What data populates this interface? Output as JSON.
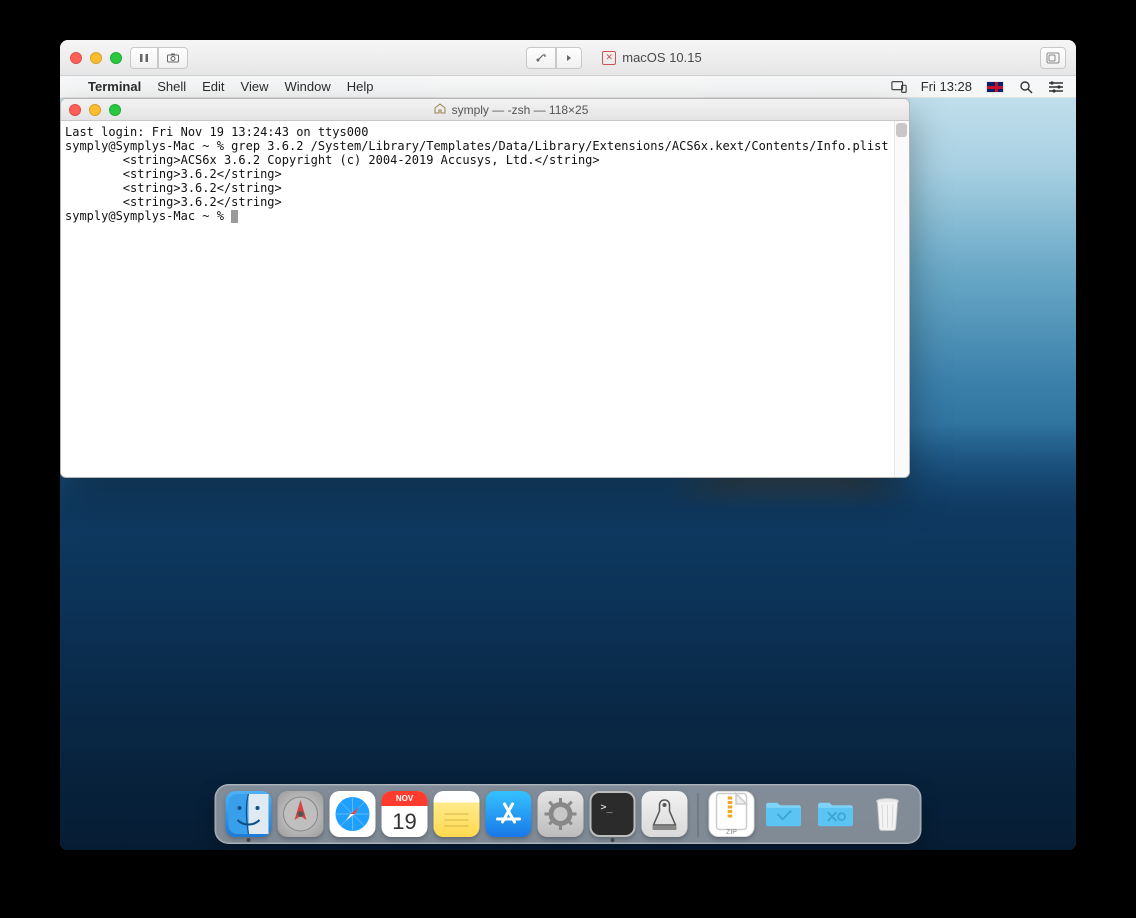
{
  "vm": {
    "os_label": "macOS 10.15"
  },
  "menubar": {
    "app": "Terminal",
    "items": [
      "Shell",
      "Edit",
      "View",
      "Window",
      "Help"
    ],
    "clock": "Fri 13:28"
  },
  "terminal": {
    "title": "symply — -zsh — 118×25",
    "lines": [
      "Last login: Fri Nov 19 13:24:43 on ttys000",
      "symply@Symplys-Mac ~ % grep 3.6.2 /System/Library/Templates/Data/Library/Extensions/ACS6x.kext/Contents/Info.plist",
      "        <string>ACS6x 3.6.2 Copyright (c) 2004-2019 Accusys, Ltd.</string>",
      "        <string>3.6.2</string>",
      "        <string>3.6.2</string>",
      "        <string>3.6.2</string>"
    ],
    "prompt": "symply@Symplys-Mac ~ % "
  },
  "dock": {
    "items": [
      {
        "name": "finder",
        "running": true
      },
      {
        "name": "launchpad",
        "running": false
      },
      {
        "name": "safari",
        "running": false
      },
      {
        "name": "calendar",
        "running": false,
        "month": "NOV",
        "day": "19"
      },
      {
        "name": "notes",
        "running": false
      },
      {
        "name": "appstore",
        "running": false
      },
      {
        "name": "system-preferences",
        "running": false
      },
      {
        "name": "terminal",
        "running": true
      },
      {
        "name": "xcode-instruments",
        "running": false
      }
    ],
    "right_items": [
      {
        "name": "zip",
        "label": "ZIP"
      },
      {
        "name": "folder-1"
      },
      {
        "name": "folder-2"
      },
      {
        "name": "trash"
      }
    ]
  }
}
